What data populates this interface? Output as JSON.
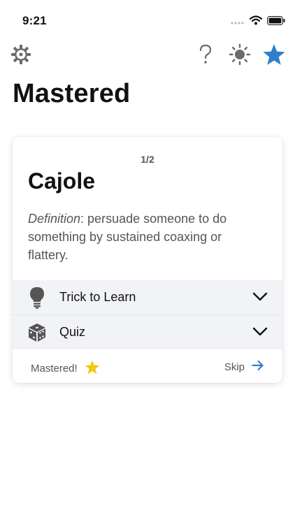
{
  "status_bar": {
    "time": "9:21",
    "icons": [
      "signal-icon",
      "wifi-icon",
      "battery-icon"
    ]
  },
  "toolbar": {
    "left_icon": "gear-icon",
    "right_icons": [
      "help-icon",
      "brightness-icon",
      "star-icon"
    ],
    "accent_color": "#2f80c9"
  },
  "page": {
    "title": "Mastered"
  },
  "card": {
    "counter": "1/2",
    "word": "Cajole",
    "definition_label": "Definition",
    "definition_text": ": persuade someone to do something by sustained coaxing or flattery.",
    "sections": [
      {
        "label": "Trick to Learn",
        "icon": "lightbulb-icon"
      },
      {
        "label": "Quiz",
        "icon": "dice-icon"
      }
    ],
    "footer": {
      "mastered_label": "Mastered!",
      "skip_label": "Skip",
      "star_color": "#f5c518",
      "arrow_color": "#2f80c9"
    }
  }
}
